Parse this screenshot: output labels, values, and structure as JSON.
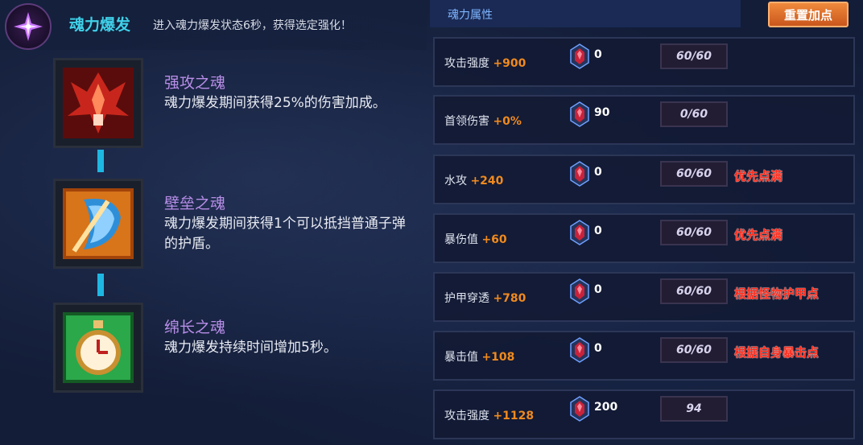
{
  "burst": {
    "title": "魂力爆发",
    "desc": "进入魂力爆发状态6秒，获得选定强化！"
  },
  "souls": [
    {
      "name": "强攻之魂",
      "desc": "魂力爆发期间获得25%的伤害加成。",
      "icon": "red-warrior-soul-icon",
      "color": "#b3221a"
    },
    {
      "name": "壁垒之魂",
      "desc": "魂力爆发期间获得1个可以抵挡普通子弹的护盾。",
      "icon": "orange-shield-soul-icon",
      "color": "#d46a12"
    },
    {
      "name": "绵长之魂",
      "desc": "魂力爆发持续时间增加5秒。",
      "icon": "green-stopwatch-soul-icon",
      "color": "#1f8f3a"
    }
  ],
  "attributes": {
    "title": "魂力属性",
    "reset_label": "重置加点",
    "rows": [
      {
        "label": "攻击强度",
        "bonus": "+900",
        "gems": "0",
        "points": "60/60",
        "note": ""
      },
      {
        "label": "首领伤害",
        "bonus": "+0%",
        "gems": "90",
        "points": "0/60",
        "note": ""
      },
      {
        "label": "水攻",
        "bonus": "+240",
        "gems": "0",
        "points": "60/60",
        "note": "优先点满"
      },
      {
        "label": "暴伤值",
        "bonus": "+60",
        "gems": "0",
        "points": "60/60",
        "note": "优先点满"
      },
      {
        "label": "护甲穿透",
        "bonus": "+780",
        "gems": "0",
        "points": "60/60",
        "note": "根据怪物护甲点"
      },
      {
        "label": "暴击值",
        "bonus": "+108",
        "gems": "0",
        "points": "60/60",
        "note": "根据自身暴击点"
      },
      {
        "label": "攻击强度",
        "bonus": "+1128",
        "gems": "200",
        "points": "94",
        "note": ""
      }
    ]
  },
  "colors": {
    "title_cyan": "#3fd0e8",
    "soul_name_purple": "#b88ee8",
    "bonus_orange": "#f08a1e",
    "note_red": "#ff2a1a",
    "connector_blue": "#1eb7e2"
  }
}
